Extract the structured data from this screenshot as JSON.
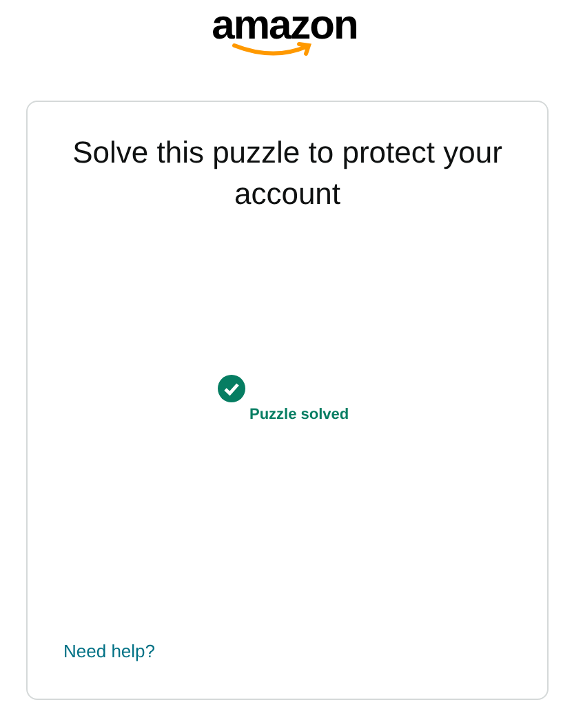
{
  "logo": {
    "text": "amazon"
  },
  "card": {
    "title": "Solve this puzzle to protect your account",
    "status": {
      "kind": "solved",
      "text": "Puzzle solved"
    },
    "help_link": "Need help?"
  }
}
